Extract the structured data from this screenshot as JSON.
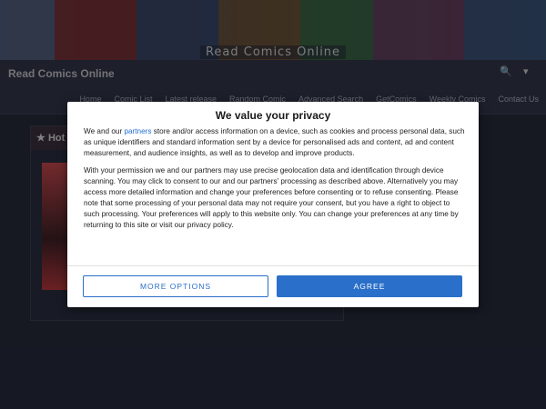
{
  "banner": {
    "title": "Read Comics Online"
  },
  "navbar": {
    "brand": "Read Comics Online",
    "search_icon": "search-icon",
    "user_icon": "user-icon",
    "links": [
      "Home",
      "Comic List",
      "Latest release",
      "Random Comic",
      "Advanced Search",
      "GetComics",
      "Weekly Comics",
      "Contact Us"
    ]
  },
  "hot_panel": {
    "icon": "star-icon",
    "title": "Hot"
  },
  "privacy": {
    "title": "We value your privacy",
    "para1_before": "We and our ",
    "para1_link": "partners",
    "para1_after": " store and/or access information on a device, such as cookies and process personal data, such as unique identifiers and standard information sent by a device for personalised ads and content, ad and content measurement, and audience insights, as well as to develop and improve products.",
    "para2": "With your permission we and our partners may use precise geolocation data and identification through device scanning. You may click to consent to our and our partners’ processing as described above. Alternatively you may access more detailed information and change your preferences before consenting or to refuse consenting. Please note that some processing of your personal data may not require your consent, but you have a right to object to such processing. Your preferences will apply to this website only. You can change your preferences at any time by returning to this site or visit our privacy policy.",
    "more_options_label": "MORE OPTIONS",
    "agree_label": "AGREE",
    "colors": {
      "accent": "#2a6fc9"
    }
  }
}
